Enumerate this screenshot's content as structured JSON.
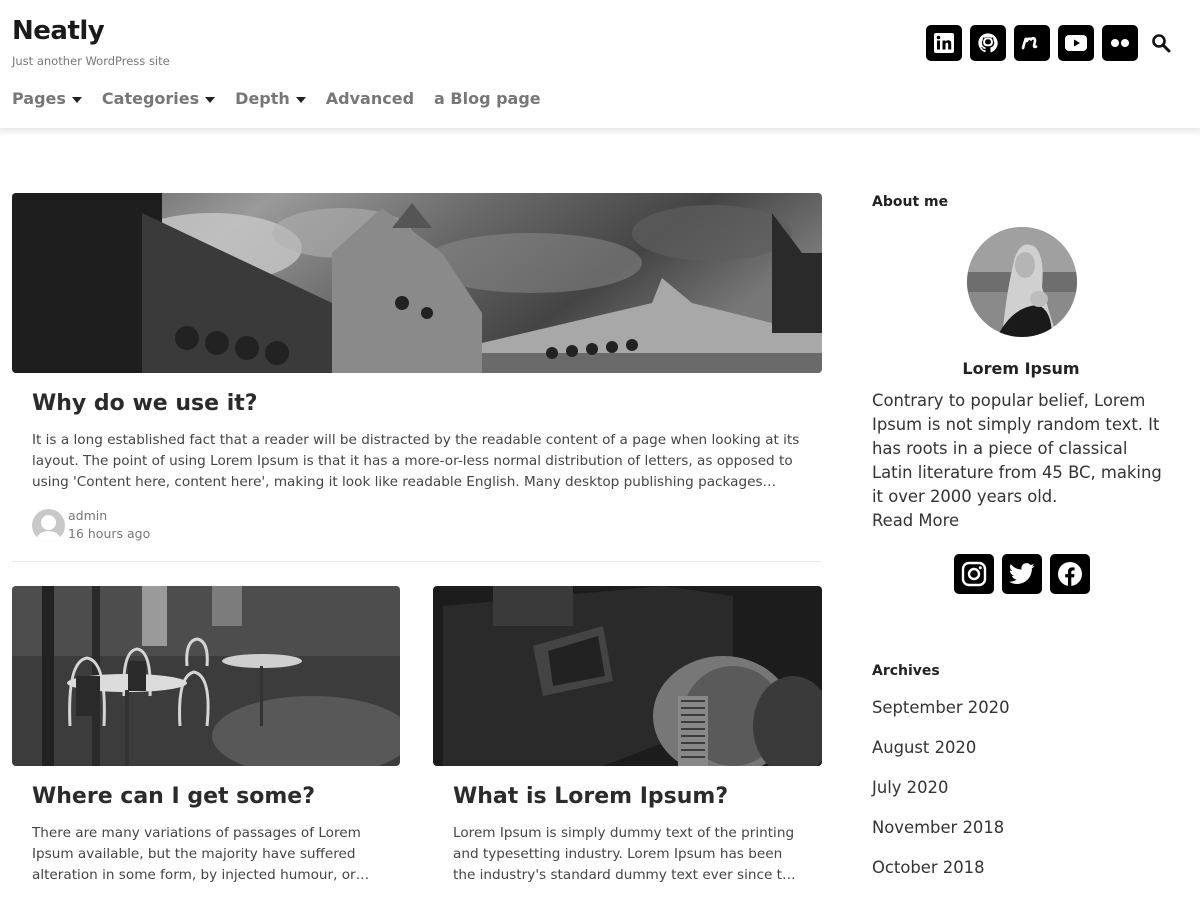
{
  "site": {
    "title": "Neatly",
    "tagline": "Just another WordPress site"
  },
  "nav": [
    {
      "label": "Pages",
      "has_dropdown": true
    },
    {
      "label": "Categories",
      "has_dropdown": true
    },
    {
      "label": "Depth",
      "has_dropdown": true
    },
    {
      "label": "Advanced",
      "has_dropdown": false
    },
    {
      "label": "a Blog page",
      "has_dropdown": false
    }
  ],
  "header_social": [
    {
      "icon": "linkedin-icon"
    },
    {
      "icon": "github-icon"
    },
    {
      "icon": "meetup-icon"
    },
    {
      "icon": "youtube-icon"
    },
    {
      "icon": "flickr-icon"
    }
  ],
  "search": {
    "icon": "search-icon"
  },
  "posts": [
    {
      "title": "Why do we use it?",
      "excerpt": "It is a long established fact that a reader will be distracted by the readable content of a page when looking at its layout. The point of using Lorem Ipsum is that it has a more-or-less normal distribution of letters, as opposed to using 'Content here, content here', making it look like readable English. Many desktop publishing packages…",
      "author": "admin",
      "time": "16 hours ago",
      "image": "grayscale photo of ornate cemetery building under cloudy sky"
    },
    {
      "title": "Where can I get some?",
      "excerpt": "There are many variations of passages of Lorem Ipsum available, but the majority have suffered alteration in some form, by injected humour, or…",
      "image": "grayscale photo of cafe chairs and tables"
    },
    {
      "title": "What is Lorem Ipsum?",
      "excerpt": "Lorem Ipsum is simply dummy text of the printing and typesetting industry. Lorem Ipsum has been the industry's standard dummy text ever since t…",
      "image": "grayscale close-up of a vintage camera lens"
    }
  ],
  "sidebar": {
    "about": {
      "title": "About me",
      "name": "Lorem Ipsum",
      "text": "Contrary to popular belief, Lorem Ipsum is not simply random text. It has roots in a piece of classical Latin literature from 45 BC, making it over 2000 years old.",
      "read_more": "Read More",
      "social": [
        {
          "icon": "instagram-icon"
        },
        {
          "icon": "twitter-icon"
        },
        {
          "icon": "facebook-icon"
        }
      ]
    },
    "archives": {
      "title": "Archives",
      "items": [
        "September 2020",
        "August 2020",
        "July 2020",
        "November 2018",
        "October 2018"
      ]
    }
  }
}
